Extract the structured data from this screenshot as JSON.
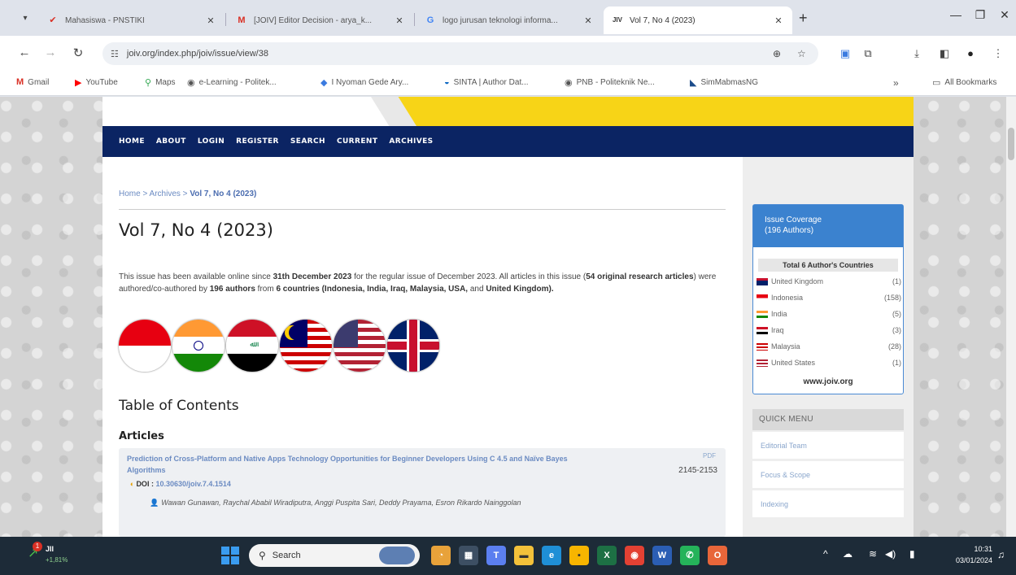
{
  "browser": {
    "tabs": [
      {
        "title": "Mahasiswa - PNSTIKI",
        "icon": "check-mark-icon",
        "icon_color": "#d93025"
      },
      {
        "title": "[JOIV] Editor Decision - arya_k...",
        "icon": "gmail-icon",
        "icon_color": "#d93025"
      },
      {
        "title": "logo jurusan teknologi informa...",
        "icon": "google-icon",
        "icon_color": "#4285f4"
      },
      {
        "title": "Vol 7, No 4 (2023)",
        "icon": "joiv-icon",
        "icon_color": "#333333",
        "active": true
      }
    ],
    "url": "joiv.org/index.php/joiv/issue/view/38",
    "bookmarks": [
      {
        "label": "Gmail",
        "icon": "gmail-icon"
      },
      {
        "label": "YouTube",
        "icon": "youtube-icon"
      },
      {
        "label": "Maps",
        "icon": "maps-pin-icon"
      },
      {
        "label": "e-Learning - Politek...",
        "icon": "elearning-icon"
      },
      {
        "label": "I Nyoman Gede Ary...",
        "icon": "bookmark-icon"
      },
      {
        "label": "SINTA | Author Dat...",
        "icon": "sinta-icon"
      },
      {
        "label": "PNB - Politeknik Ne...",
        "icon": "pnb-icon"
      },
      {
        "label": "SimMabmasNG",
        "icon": "sim-icon"
      }
    ],
    "bookmarks_overflow": "»",
    "all_bookmarks": "All Bookmarks"
  },
  "site": {
    "nav": [
      "HOME",
      "ABOUT",
      "LOGIN",
      "REGISTER",
      "SEARCH",
      "CURRENT",
      "ARCHIVES"
    ],
    "breadcrumb": {
      "home": "Home",
      "archives": "Archives",
      "sep": " > ",
      "current": "Vol 7, No 4 (2023)"
    },
    "page_title": "Vol 7, No 4 (2023)",
    "desc": {
      "p1": "This issue has been available online since ",
      "b1": "31th December 2023",
      "p2": " for the regular issue of December 2023. All articles in this issue (",
      "b2": "54 original research articles",
      "p3": ") were authored/co-authored by ",
      "b3": "196 authors",
      "p4": " from ",
      "b4": "6 countries (Indonesia, India, Iraq, Malaysia, USA,",
      "p5": " and ",
      "b5": "United Kingdom).",
      "p6": ""
    },
    "toc_title": "Table of Contents",
    "articles_title": "Articles",
    "article": {
      "title": "Prediction of Cross-Platform and Native Apps Technology Opportunities for Beginner Developers Using C 4.5 and Naïve Bayes Algorithms",
      "doi_label": "DOI : ",
      "doi": "10.30630/joiv.7.4.1514",
      "authors": "Wawan Gunawan, Raychal Ababil Wiradiputra, Anggi Puspita Sari, Deddy Prayama, Esron Rikardo Nainggolan",
      "pdf": "PDF",
      "pages": "2145-2153"
    },
    "coverage": {
      "head": "Issue Coverage",
      "head2": "(196 Authors)",
      "subhead": "Total 6 Author's Countries",
      "countries": [
        {
          "name": "United Kingdom",
          "count": "(1)"
        },
        {
          "name": "Indonesia",
          "count": "(158)"
        },
        {
          "name": "India",
          "count": "(5)"
        },
        {
          "name": "Iraq",
          "count": "(3)"
        },
        {
          "name": "Malaysia",
          "count": "(28)"
        },
        {
          "name": "United States",
          "count": "(1)"
        }
      ],
      "site": "www.joiv.org"
    },
    "quick_menu": {
      "head": "QUICK MENU",
      "items": [
        "Editorial Team",
        "Focus & Scope",
        "Indexing"
      ]
    }
  },
  "taskbar": {
    "weather_temp": "JII",
    "weather_change": "+1,81%",
    "weather_badge": "1",
    "search_placeholder": "Search",
    "time": "10:31",
    "date": "03/01/2024"
  },
  "colors": {
    "navbar": "#0b2463",
    "banner": "#f7d417",
    "coverage": "#3b82cf",
    "link": "#6b8bc2",
    "taskbar": "#1d2b38"
  }
}
